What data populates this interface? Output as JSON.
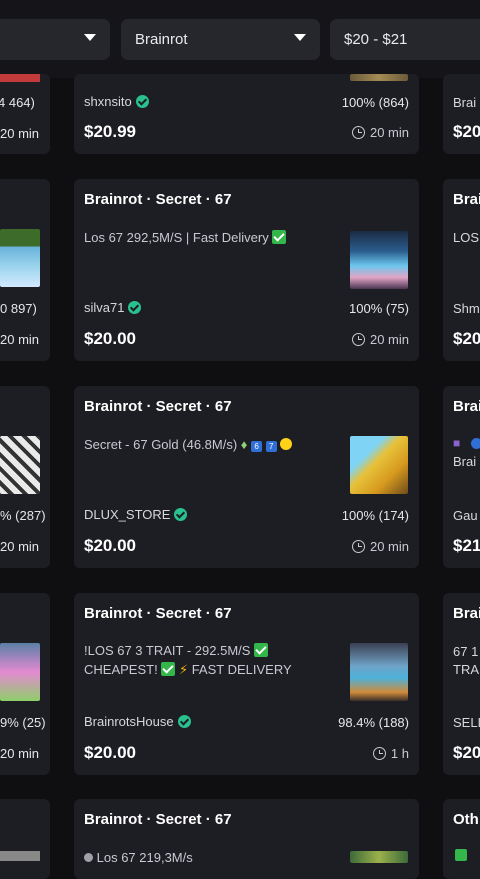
{
  "filters": {
    "game_select": "",
    "category_select": "Brainrot",
    "price_select": "$20 - $21"
  },
  "left_column": {
    "row0": {
      "rating": "4 464)",
      "time": "20 min"
    },
    "row1": {
      "rating": "0 897)",
      "time": "20 min"
    },
    "row2": {
      "rating": "% (287)",
      "time": "20 min"
    },
    "row3": {
      "rating": "9% (25)",
      "time": "20 min"
    }
  },
  "listings": [
    {
      "title": "",
      "desc": "",
      "seller": "shxnsito",
      "rating": "100% (864)",
      "price": "$20.99",
      "time": "20 min"
    },
    {
      "title": "Brainrot · Secret · 67",
      "desc": "Los 67 292,5M/S | Fast Delivery",
      "seller": "silva71",
      "rating": "100% (75)",
      "price": "$20.00",
      "time": "20 min"
    },
    {
      "title": "Brainrot · Secret · 67",
      "desc": "Secret - 67 Gold (46.8M/s)",
      "seller": "DLUX_STORE",
      "rating": "100% (174)",
      "price": "$20.00",
      "time": "20 min"
    },
    {
      "title": "Brainrot · Secret · 67",
      "desc_line1": "!LOS 67 3 TRAIT - 292.5M/S",
      "desc_line2_a": "CHEAPEST!",
      "desc_line2_b": "FAST DELIVERY",
      "seller": "BrainrotsHouse",
      "rating": "98.4% (188)",
      "price": "$20.00",
      "time": "1 h"
    },
    {
      "title": "Brainrot · Secret · 67",
      "desc": "Los 67 219,3M/s"
    }
  ],
  "right_column": {
    "row0": {
      "label": "Brai",
      "price": "$20"
    },
    "row1": {
      "title": "Brai",
      "desc": "LOS",
      "seller": "Shm",
      "price": "$20"
    },
    "row2": {
      "title": "Brai",
      "desc": "Brai",
      "seller": "Gau",
      "price": "$21"
    },
    "row3": {
      "title": "Brai",
      "desc1": "67 1",
      "desc2": "TRA",
      "seller": "SELL",
      "price": "$20"
    },
    "row4": {
      "title": "Oth"
    }
  },
  "icons": {
    "verified": "verified-check-icon",
    "clock": "clock-icon",
    "check": "green-check-emoji",
    "bolt": "lightning-emoji"
  },
  "colors": {
    "background": "#0f0f12",
    "card": "#1d1d24",
    "verified": "#29c28f",
    "dropdown": "#26262d"
  }
}
